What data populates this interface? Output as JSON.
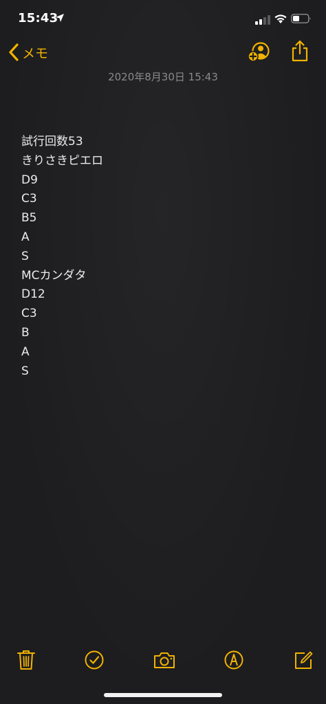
{
  "status_bar": {
    "time": "15:43"
  },
  "nav": {
    "back_label": "メモ"
  },
  "note": {
    "date": "2020年8月30日 15:43",
    "lines": [
      "試行回数53",
      "きりさきピエロ",
      "D9",
      "C3",
      "B5",
      "A",
      "S",
      "MCカンダタ",
      "D12",
      "C3",
      "B",
      "A",
      "S"
    ]
  },
  "colors": {
    "accent": "#f2b300",
    "background": "#1d1d1f",
    "text": "#ebebeb",
    "date_text": "#8a8a8e"
  },
  "icons": {
    "toolbar": [
      "trash-icon",
      "checklist-icon",
      "camera-icon",
      "markup-icon",
      "compose-icon"
    ]
  }
}
